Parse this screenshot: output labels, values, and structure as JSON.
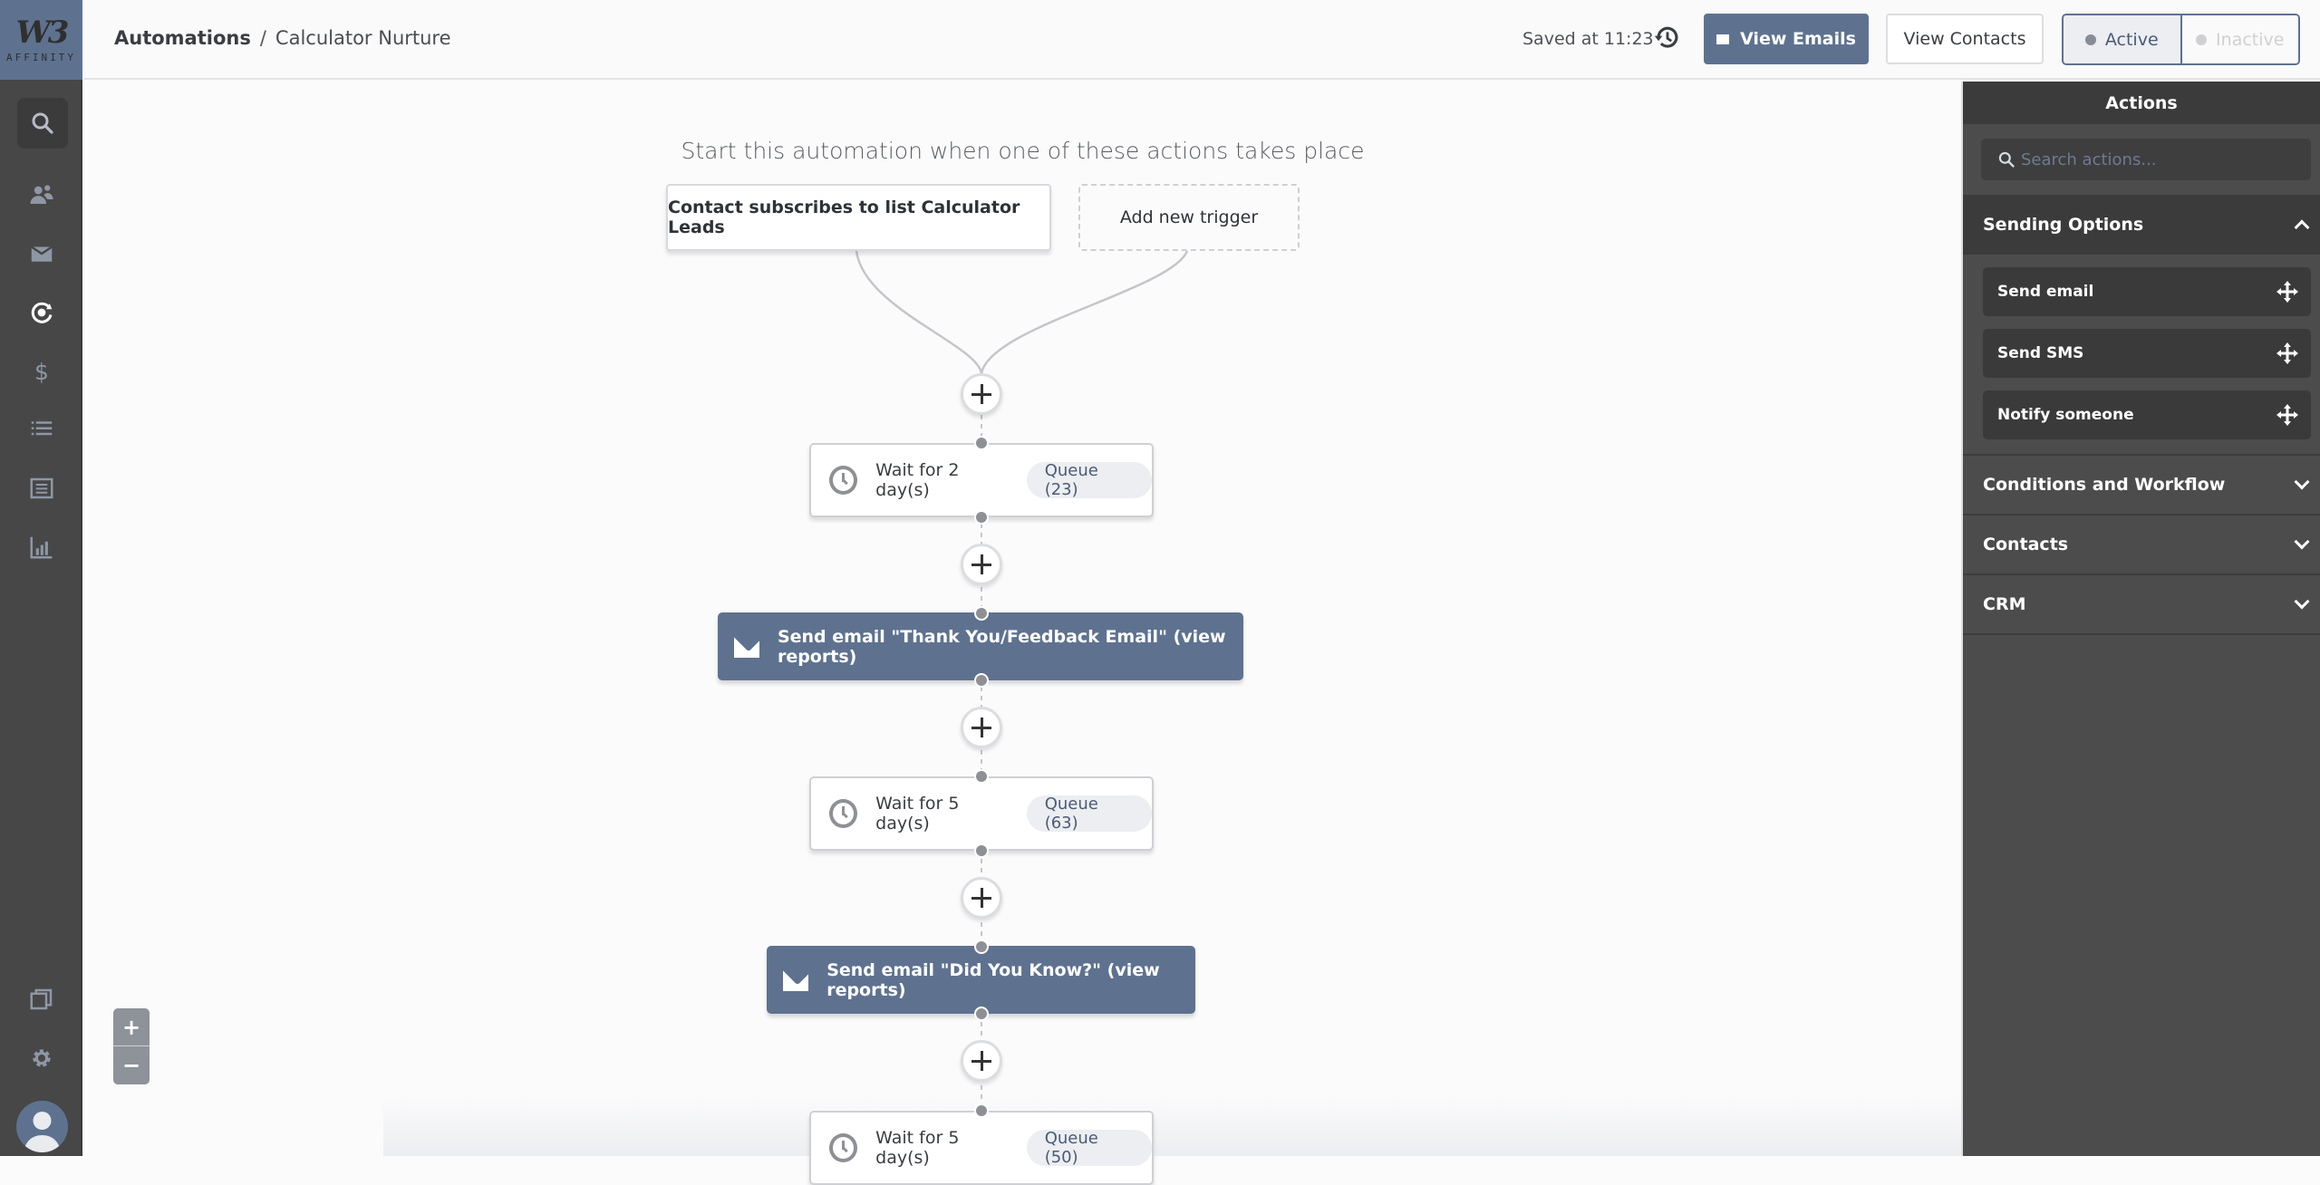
{
  "app": {
    "logo_text": "W3",
    "logo_word": "AFFINITY"
  },
  "sidebar": {
    "items": [
      {
        "name": "search",
        "icon": "search-icon"
      },
      {
        "name": "contacts",
        "icon": "users-icon"
      },
      {
        "name": "email",
        "icon": "envelope-icon"
      },
      {
        "name": "automations",
        "icon": "automation-gear-icon",
        "active": true
      },
      {
        "name": "deals",
        "icon": "dollar-icon"
      },
      {
        "name": "lists",
        "icon": "list-icon"
      },
      {
        "name": "forms",
        "icon": "form-icon"
      },
      {
        "name": "reports",
        "icon": "bar-chart-icon"
      }
    ],
    "bottom": [
      {
        "name": "pages",
        "icon": "copy-icon"
      },
      {
        "name": "settings",
        "icon": "gear-icon"
      },
      {
        "name": "profile",
        "icon": "avatar-icon"
      }
    ]
  },
  "header": {
    "breadcrumb_root": "Automations",
    "breadcrumb_sep": "/",
    "breadcrumb_current": "Calculator Nurture",
    "saved_text": "Saved at 11:23",
    "view_emails": "View Emails",
    "view_contacts": "View Contacts",
    "status_active": "Active",
    "status_inactive": "Inactive"
  },
  "canvas": {
    "start_title": "Start this automation when one of these actions takes place",
    "triggers": [
      {
        "label": "Contact subscribes to list Calculator Leads"
      },
      {
        "label": "Add new trigger"
      }
    ],
    "steps": [
      {
        "type": "wait",
        "label": "Wait for 2 day(s)",
        "queue": "Queue (23)"
      },
      {
        "type": "email",
        "label": "Send email \"Thank You/Feedback Email\" (view reports)"
      },
      {
        "type": "wait",
        "label": "Wait for 5 day(s)",
        "queue": "Queue (63)"
      },
      {
        "type": "email",
        "label": "Send email \"Did You Know?\" (view reports)"
      },
      {
        "type": "wait",
        "label": "Wait for 5 day(s)",
        "queue": "Queue (50)"
      }
    ],
    "zoom_in": "+",
    "zoom_out": "−"
  },
  "panel": {
    "title": "Actions",
    "search_placeholder": "Search actions...",
    "sections": [
      {
        "label": "Sending Options",
        "open": true,
        "items": [
          "Send email",
          "Send SMS",
          "Notify someone"
        ]
      },
      {
        "label": "Conditions and Workflow",
        "open": false
      },
      {
        "label": "Contacts",
        "open": false
      },
      {
        "label": "CRM",
        "open": false
      }
    ]
  },
  "colors": {
    "accent": "#5e7290",
    "sidebar": "#474747",
    "panel": "#4c4c4c"
  }
}
